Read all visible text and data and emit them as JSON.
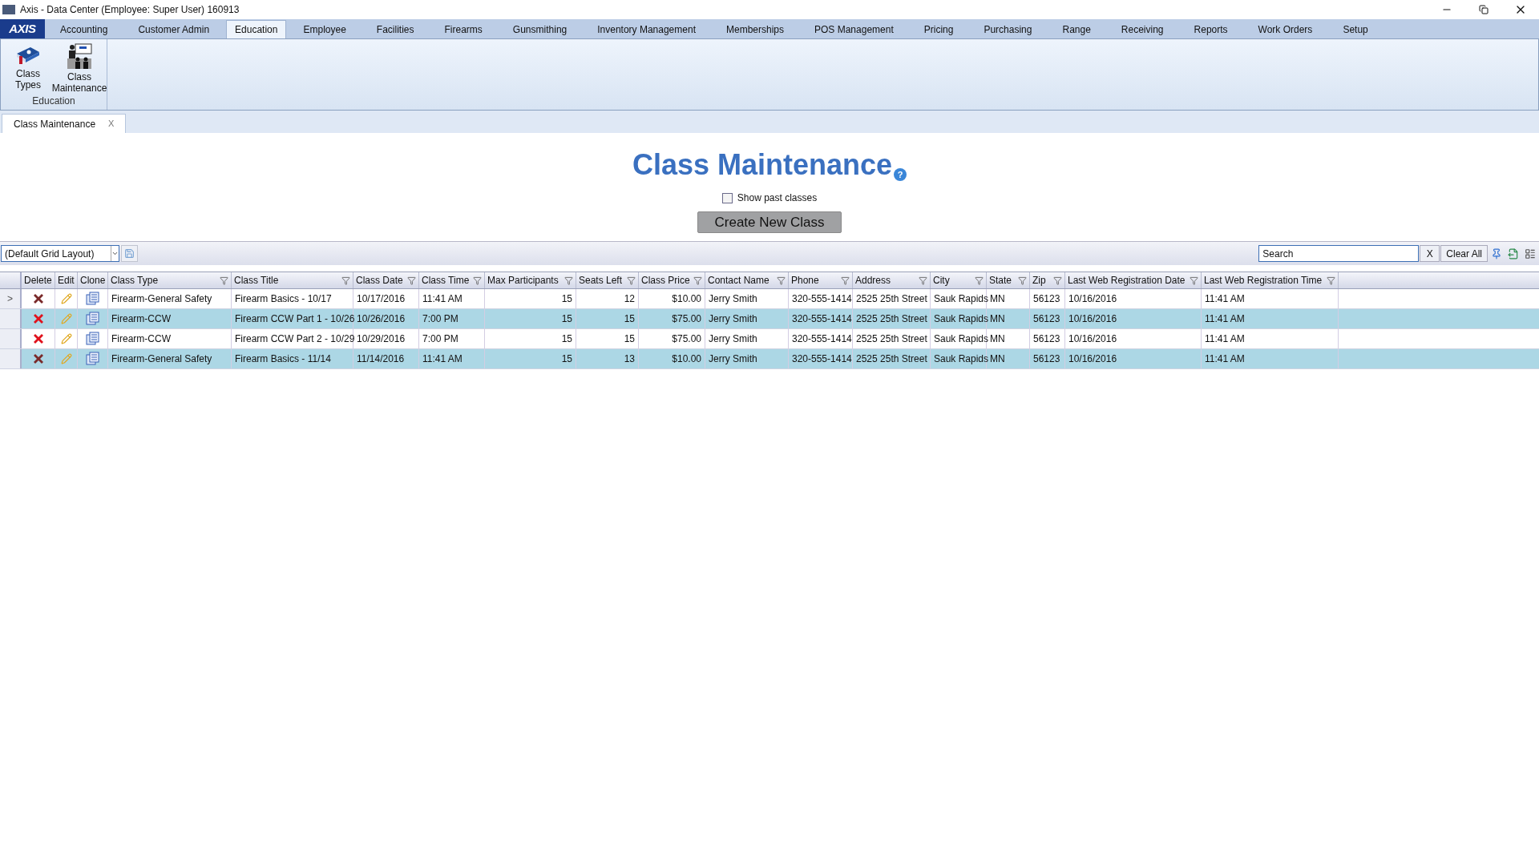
{
  "window": {
    "title": "Axis - Data Center  (Employee: Super User) 160913",
    "logo": "AXIS"
  },
  "menu_tabs": [
    {
      "label": "Accounting",
      "selected": false
    },
    {
      "label": "Customer Admin",
      "selected": false
    },
    {
      "label": "Education",
      "selected": true
    },
    {
      "label": "Employee",
      "selected": false
    },
    {
      "label": "Facilities",
      "selected": false
    },
    {
      "label": "Firearms",
      "selected": false
    },
    {
      "label": "Gunsmithing",
      "selected": false
    },
    {
      "label": "Inventory Management",
      "selected": false
    },
    {
      "label": "Memberships",
      "selected": false
    },
    {
      "label": "POS Management",
      "selected": false
    },
    {
      "label": "Pricing",
      "selected": false
    },
    {
      "label": "Purchasing",
      "selected": false
    },
    {
      "label": "Range",
      "selected": false
    },
    {
      "label": "Receiving",
      "selected": false
    },
    {
      "label": "Reports",
      "selected": false
    },
    {
      "label": "Work Orders",
      "selected": false
    },
    {
      "label": "Setup",
      "selected": false
    }
  ],
  "ribbon": {
    "group": "Education",
    "buttons": [
      {
        "kind": "book",
        "label": "Class Types"
      },
      {
        "kind": "classroom",
        "label": "Class Maintenance"
      }
    ]
  },
  "document_tabs": [
    {
      "label": "Class Maintenance",
      "close": "X",
      "selected": true
    }
  ],
  "page": {
    "title": "Class Maintenance",
    "help": "?",
    "show_past": {
      "label": "Show past classes",
      "checked": false
    },
    "create_button": "Create New Class"
  },
  "grid_toolbar": {
    "layout": "(Default Grid Layout)",
    "search_placeholder": "Search",
    "clear_x": "X",
    "clear_all": "Clear All"
  },
  "table": {
    "current_marker": ">",
    "columns": [
      {
        "label": "Delete",
        "kind": "delete",
        "filter": false
      },
      {
        "label": "Edit",
        "kind": "edit",
        "filter": false
      },
      {
        "label": "Clone",
        "kind": "clone",
        "filter": false
      },
      {
        "label": "Class Type",
        "kind": "text",
        "filter": true
      },
      {
        "label": "Class Title",
        "kind": "text",
        "filter": true
      },
      {
        "label": "Class Date",
        "kind": "text",
        "filter": true
      },
      {
        "label": "Class Time",
        "kind": "text",
        "filter": true
      },
      {
        "label": "Max Participants",
        "kind": "number",
        "filter": true
      },
      {
        "label": "Seats Left",
        "kind": "number",
        "filter": true
      },
      {
        "label": "Class Price",
        "kind": "number",
        "filter": true
      },
      {
        "label": "Contact Name",
        "kind": "text",
        "filter": true
      },
      {
        "label": "Phone",
        "kind": "text",
        "filter": true
      },
      {
        "label": "Address",
        "kind": "text",
        "filter": true
      },
      {
        "label": "City",
        "kind": "text",
        "filter": true
      },
      {
        "label": "State",
        "kind": "text",
        "filter": true
      },
      {
        "label": "Zip",
        "kind": "text",
        "filter": true
      },
      {
        "label": "Last Web Registration Date",
        "kind": "text",
        "filter": true
      },
      {
        "label": "Last Web Registration Time",
        "kind": "text",
        "filter": true
      }
    ],
    "rows": [
      {
        "current": true,
        "selected": false,
        "delete_enabled": false,
        "cells": [
          "",
          "",
          "",
          "Firearm-General Safety",
          "Firearm Basics - 10/17",
          "10/17/2016",
          "11:41 AM",
          "15",
          "12",
          "$10.00",
          "Jerry Smith",
          "320-555-1414",
          "2525 25th Street",
          "Sauk Rapids",
          "MN",
          "56123",
          "10/16/2016",
          "11:41 AM"
        ]
      },
      {
        "current": false,
        "selected": true,
        "delete_enabled": true,
        "cells": [
          "",
          "",
          "",
          "Firearm-CCW",
          "Firearm CCW Part 1 - 10/26",
          "10/26/2016",
          "7:00 PM",
          "15",
          "15",
          "$75.00",
          "Jerry Smith",
          "320-555-1414",
          "2525 25th Street",
          "Sauk Rapids",
          "MN",
          "56123",
          "10/16/2016",
          "11:41 AM"
        ]
      },
      {
        "current": false,
        "selected": false,
        "delete_enabled": true,
        "cells": [
          "",
          "",
          "",
          "Firearm-CCW",
          "Firearm CCW Part 2 - 10/29",
          "10/29/2016",
          "7:00 PM",
          "15",
          "15",
          "$75.00",
          "Jerry Smith",
          "320-555-1414",
          "2525 25th Street",
          "Sauk Rapids",
          "MN",
          "56123",
          "10/16/2016",
          "11:41 AM"
        ]
      },
      {
        "current": false,
        "selected": true,
        "delete_enabled": false,
        "cells": [
          "",
          "",
          "",
          "Firearm-General Safety",
          "Firearm Basics - 11/14",
          "11/14/2016",
          "11:41 AM",
          "15",
          "13",
          "$10.00",
          "Jerry Smith",
          "320-555-1414",
          "2525 25th Street",
          "Sauk Rapids",
          "MN",
          "56123",
          "10/16/2016",
          "11:41 AM"
        ]
      }
    ]
  }
}
